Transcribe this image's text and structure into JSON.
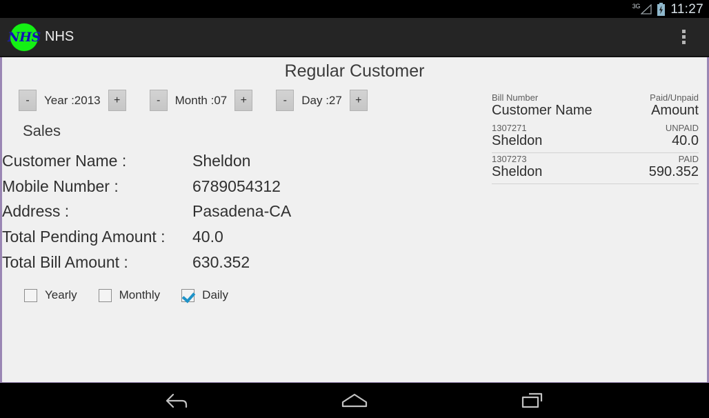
{
  "status_bar": {
    "network_label": "3G",
    "signal_icon": "signal-triangle-icon",
    "battery_icon": "battery-charging-icon",
    "clock": "11:27"
  },
  "action_bar": {
    "logo_text": "NHS",
    "logo_icon": "nhs-logo-icon",
    "app_title": "NHS",
    "overflow_icon": "overflow-menu-icon",
    "background_color": "#252525"
  },
  "screen": {
    "title": "Regular Customer",
    "background_color": "#f0f0f0",
    "border_color": "#9a86b4"
  },
  "steppers": [
    {
      "name": "year",
      "minus": "-",
      "label": "Year :2013",
      "plus": "+"
    },
    {
      "name": "month",
      "minus": "-",
      "label": "Month :07",
      "plus": "+"
    },
    {
      "name": "day",
      "minus": "-",
      "label": "Day :27",
      "plus": "+"
    }
  ],
  "sales": {
    "heading": "Sales",
    "rows": [
      {
        "label": "Customer Name :",
        "value": "Sheldon"
      },
      {
        "label": "Mobile Number :",
        "value": "6789054312"
      },
      {
        "label": "Address :",
        "value": "Pasadena-CA"
      },
      {
        "label": "Total Pending Amount :",
        "value": "40.0"
      },
      {
        "label": "Total Bill Amount :",
        "value": "630.352"
      }
    ]
  },
  "period_filters": [
    {
      "label": "Yearly",
      "checked": false
    },
    {
      "label": "Monthly",
      "checked": false
    },
    {
      "label": "Daily",
      "checked": true
    }
  ],
  "checkbox_accent_color": "#1e93c8",
  "bill_list": {
    "header": {
      "bill_number": "Bill Number",
      "paid_status": "Paid/Unpaid",
      "customer_name": "Customer Name",
      "amount": "Amount"
    },
    "entries": [
      {
        "bill_number": "1307271",
        "status": "UNPAID",
        "customer_name": "Sheldon",
        "amount": "40.0"
      },
      {
        "bill_number": "1307273",
        "status": "PAID",
        "customer_name": "Sheldon",
        "amount": "590.352"
      }
    ]
  },
  "nav_bar": {
    "back_icon": "back-arrow-icon",
    "home_icon": "home-icon",
    "recents_icon": "recent-apps-icon"
  }
}
